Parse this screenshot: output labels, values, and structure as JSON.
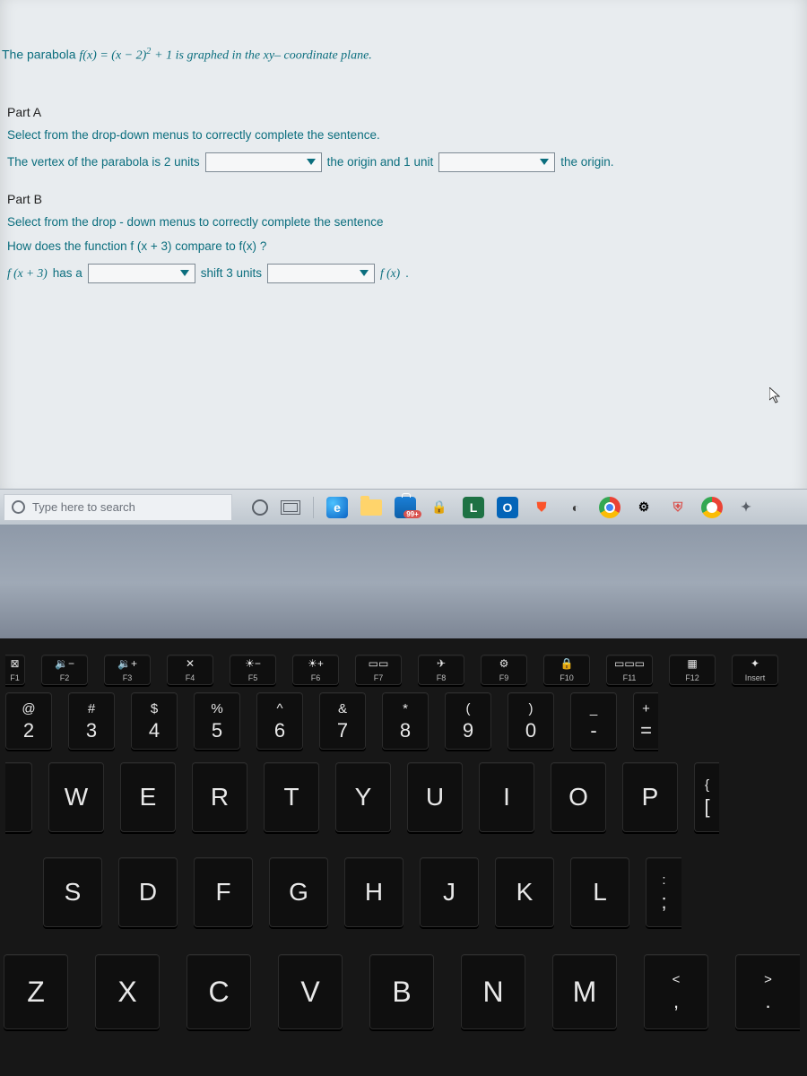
{
  "question": {
    "intro_pre": "The parabola ",
    "intro_func": "f(x) = (x − 2)",
    "intro_exp": "2",
    "intro_post": " + 1 is graphed in the xy– coordinate plane."
  },
  "partA": {
    "title": "Part A",
    "instruction": "Select from the drop-down menus to correctly complete the sentence.",
    "seg1": "The vertex of the parabola is 2 units",
    "seg2": "the origin and 1 unit",
    "seg3": "the origin."
  },
  "partB": {
    "title": "Part B",
    "instruction": "Select from the drop - down menus to correctly complete the sentence",
    "q": "How does the function ",
    "q_math": "f (x + 3)",
    "q_mid": " compare to ",
    "q_math2": "f(x)",
    "q_end": "?",
    "sent_pre": "f (x + 3)",
    "sent_hasa": " has a ",
    "sent_shift": "shift 3 units",
    "sent_fx": "f (x)",
    "sent_dot": "."
  },
  "taskbar": {
    "search_placeholder": "Type here to search",
    "badge": "99+"
  },
  "keyboard": {
    "fn": [
      {
        "icon": "⊠",
        "label": "F1"
      },
      {
        "icon": "🔉−",
        "label": "F2"
      },
      {
        "icon": "🔉+",
        "label": "F3"
      },
      {
        "icon": "✕",
        "label": "F4"
      },
      {
        "icon": "☀−",
        "label": "F5"
      },
      {
        "icon": "☀+",
        "label": "F6"
      },
      {
        "icon": "▭▭",
        "label": "F7"
      },
      {
        "icon": "✈",
        "label": "F8"
      },
      {
        "icon": "⚙",
        "label": "F9"
      },
      {
        "icon": "🔒",
        "label": "F10"
      },
      {
        "icon": "▭▭▭",
        "label": "F11"
      },
      {
        "icon": "▦",
        "label": "F12"
      },
      {
        "icon": "✦",
        "label": "Insert"
      }
    ],
    "num": [
      {
        "top": "@",
        "bot": "2"
      },
      {
        "top": "#",
        "bot": "3"
      },
      {
        "top": "$",
        "bot": "4"
      },
      {
        "top": "%",
        "bot": "5"
      },
      {
        "top": "^",
        "bot": "6"
      },
      {
        "top": "&",
        "bot": "7"
      },
      {
        "top": "*",
        "bot": "8"
      },
      {
        "top": "(",
        "bot": "9"
      },
      {
        "top": ")",
        "bot": "0"
      },
      {
        "top": "_",
        "bot": "-"
      },
      {
        "top": "+",
        "bot": "="
      }
    ],
    "q": [
      "W",
      "E",
      "R",
      "T",
      "Y",
      "U",
      "I",
      "O",
      "P"
    ],
    "q_bracket": {
      "top": "{",
      "bot": "["
    },
    "a": [
      "S",
      "D",
      "F",
      "G",
      "H",
      "J",
      "K",
      "L"
    ],
    "a_semi": {
      "top": ":",
      "bot": ";"
    },
    "z": [
      "Z",
      "X",
      "C",
      "V",
      "B",
      "N",
      "M"
    ],
    "z_comma": {
      "top": "<",
      "bot": ","
    },
    "z_period": {
      "top": ">",
      "bot": "."
    }
  }
}
